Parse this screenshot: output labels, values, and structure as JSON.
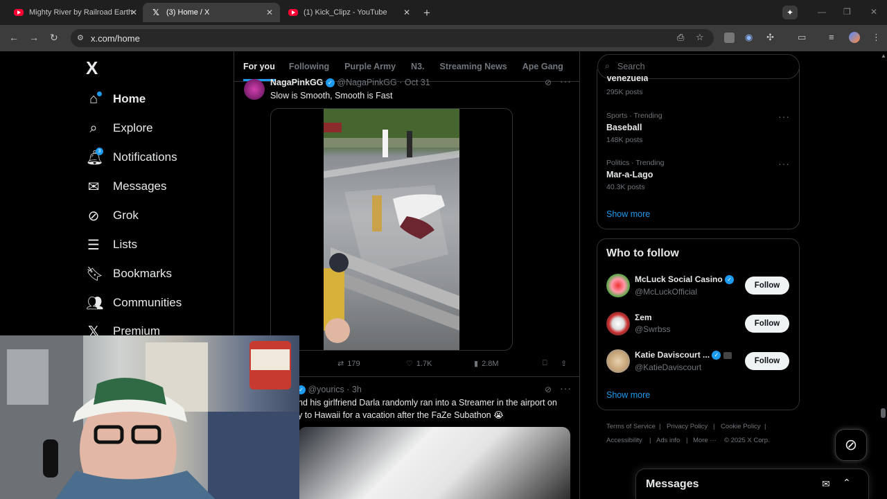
{
  "browser": {
    "tabs": [
      {
        "title": "Mighty River by Railroad Earth",
        "icon": "youtube-icon"
      },
      {
        "title": "(3) Home / X",
        "icon": "x-logo-icon"
      },
      {
        "title": "(1) Kick_Clipz - YouTube",
        "icon": "youtube-icon"
      }
    ],
    "url": "x.com/home"
  },
  "nav": {
    "logo": "X",
    "items": [
      {
        "label": "Home",
        "icon": "home-icon"
      },
      {
        "label": "Explore",
        "icon": "search-icon"
      },
      {
        "label": "Notifications",
        "icon": "bell-icon",
        "badge": "3"
      },
      {
        "label": "Messages",
        "icon": "mail-icon"
      },
      {
        "label": "Grok",
        "icon": "grok-icon"
      },
      {
        "label": "Lists",
        "icon": "list-icon"
      },
      {
        "label": "Bookmarks",
        "icon": "bookmark-icon"
      },
      {
        "label": "Communities",
        "icon": "people-icon"
      },
      {
        "label": "Premium",
        "icon": "x-logo-icon"
      }
    ]
  },
  "timeline": {
    "tabs": [
      "For you",
      "Following",
      "Purple Army",
      "N3.",
      "Streaming News",
      "Ape Gang"
    ],
    "tweet1": {
      "name": "NagaPinkGG",
      "handle": "@NagaPinkGG",
      "time": "Oct 31",
      "text": "Slow is Smooth, Smooth is Fast",
      "retweets": "179",
      "likes": "1.7K",
      "views": "2.8M"
    },
    "tweet2": {
      "handle": "@yourics",
      "time": "3h",
      "text_line1": "nd his girlfriend Darla randomly ran into a Streamer in the airport on",
      "text_line2": "y to Hawaii for a vacation after the FaZe Subathon 😭"
    }
  },
  "sidebar": {
    "search_placeholder": "Search",
    "trends": [
      {
        "category": "",
        "name": "Venezuela",
        "posts": "295K posts"
      },
      {
        "category": "Sports · Trending",
        "name": "Baseball",
        "posts": "148K posts"
      },
      {
        "category": "Politics · Trending",
        "name": "Mar-a-Lago",
        "posts": "40.3K posts"
      }
    ],
    "show_more": "Show more",
    "who_to_follow_title": "Who to follow",
    "who_to_follow": [
      {
        "name": "McLuck Social Casino",
        "handle": "@McLuckOfficial",
        "verified": true
      },
      {
        "name": "Ʃem",
        "handle": "@Swrbss",
        "verified": false
      },
      {
        "name": "Katie Daviscourt ...",
        "handle": "@KatieDaviscourt",
        "verified": true
      }
    ],
    "follow_label": "Follow",
    "show_more_2": "Show more",
    "footer": [
      "Terms of Service",
      "Privacy Policy",
      "Cookie Policy",
      "Accessibility",
      "Ads info",
      "More ···",
      "© 2025 X Corp."
    ],
    "messages_title": "Messages"
  }
}
